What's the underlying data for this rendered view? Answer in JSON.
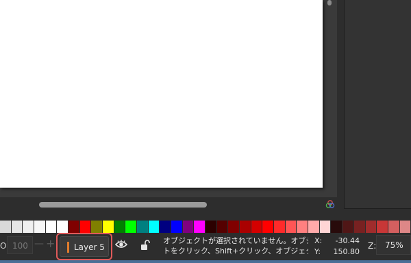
{
  "palette": {
    "colors": [
      "#d9d9d9",
      "#e6e6e6",
      "#f0f0f0",
      "#f7f7f7",
      "#ffffff",
      "#ffffff",
      "#800000",
      "#ff0000",
      "#808000",
      "#ffff00",
      "#008000",
      "#00ff00",
      "#008080",
      "#00ffff",
      "#000080",
      "#0000ff",
      "#800080",
      "#ff00ff",
      "#2b0000",
      "#550000",
      "#800000",
      "#aa0000",
      "#d40000",
      "#ff0000",
      "#ff2a2a",
      "#ff5555",
      "#ff8080",
      "#ffaaaa",
      "#ffd5d5",
      "#280b0b",
      "#501616",
      "#782121",
      "#a02c2c",
      "#c83737",
      "#d35f5f",
      "#de8787"
    ]
  },
  "opacity": {
    "label": "O:",
    "value": "100",
    "minus": "—",
    "plus": "+"
  },
  "layer": {
    "label": "Layer 5",
    "indicator_color": "#e07c2c"
  },
  "status": {
    "line1": "オブジェクトが選択されていません。オブジェクト",
    "line2": "トをクリック、Shift+クリック、オブジェクト上…"
  },
  "coords": {
    "x_label": "X:",
    "x_value": "-30.44",
    "y_label": "Y:",
    "y_value": "150.80"
  },
  "zoom": {
    "label": "Z:",
    "value": "75%"
  }
}
